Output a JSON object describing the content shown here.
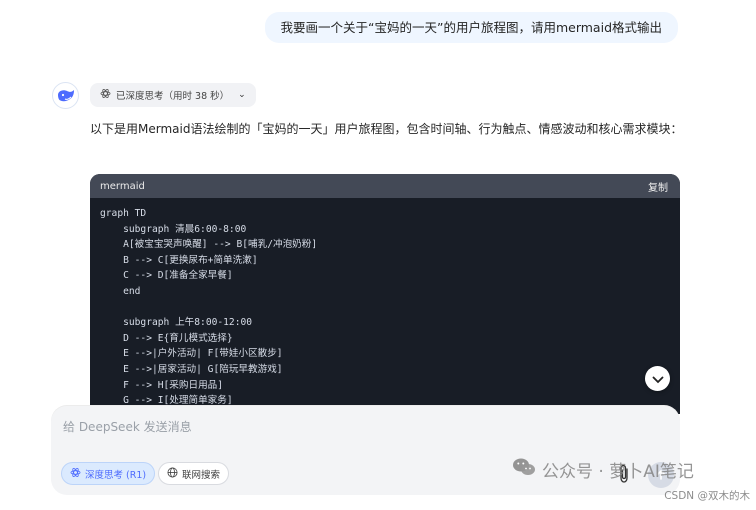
{
  "user_message": "我要画一个关于“宝妈的一天”的用户旅程图，请用mermaid格式输出",
  "assistant": {
    "thinking_label": "已深度思考（用时 38 秒）",
    "intro": "以下是用Mermaid语法绘制的「宝妈的一天」用户旅程图，包含时间轴、行为触点、情感波动和核心需求模块：",
    "code": {
      "language": "mermaid",
      "copy_label": "复制",
      "lines": [
        "graph TD",
        "    subgraph 清晨6:00-8:00",
        "    A[被宝宝哭声唤醒] --> B[哺乳/冲泡奶粉]",
        "    B --> C[更换尿布+简单洗漱]",
        "    C --> D[准备全家早餐]",
        "    end",
        "",
        "    subgraph 上午8:00-12:00",
        "    D --> E{育儿模式选择}",
        "    E -->|户外活动| F[带娃小区散步]",
        "    E -->|居家活动| G[陪玩早教游戏]",
        "    F --> H[采购日用品]",
        "    G --> I[处理简单家务]"
      ]
    }
  },
  "composer": {
    "placeholder": "给 DeepSeek 发送消息",
    "deep_think_label": "深度思考 (R1)",
    "web_search_label": "联网搜索"
  },
  "watermark": {
    "main": "公众号 · 萝卜AI笔记",
    "csdn": "CSDN @双木的木"
  },
  "colors": {
    "accent": "#4d6bfe",
    "code_bg": "#181d26",
    "code_header": "#434956",
    "user_bubble": "#eff6ff"
  }
}
